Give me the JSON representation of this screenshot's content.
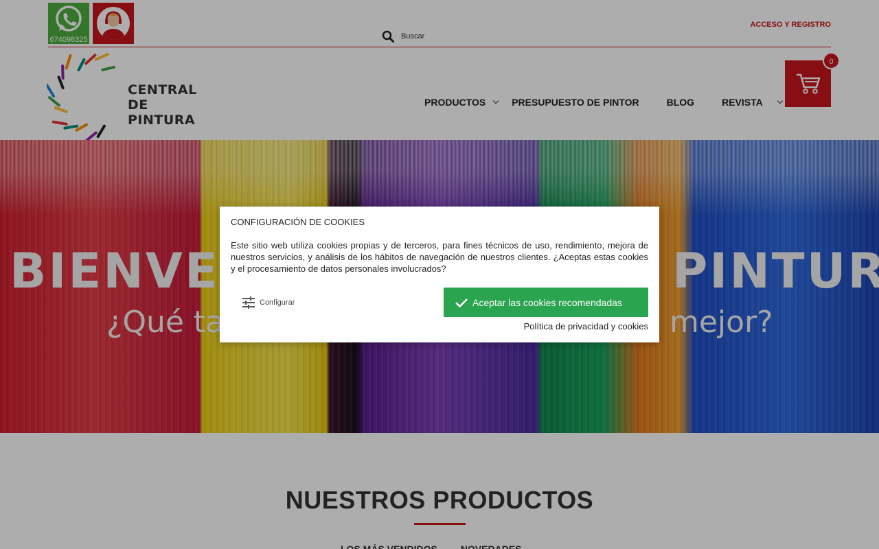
{
  "header": {
    "whatsapp_phone": "674098325",
    "search_label": "Buscar",
    "access_label": "ACCESO Y REGISTRO",
    "logo_line1": "CENTRAL",
    "logo_line2": "DE PINTURA",
    "cart_count": "0",
    "brand_color": "#c8161d",
    "whatsapp_color": "#4caf3f"
  },
  "nav": {
    "items": [
      {
        "label": "PRODUCTOS",
        "has_dropdown": true
      },
      {
        "label": "PRESUPUESTO DE PINTOR",
        "has_dropdown": false
      },
      {
        "label": "BLOG",
        "has_dropdown": false
      },
      {
        "label": "REVISTA",
        "has_dropdown": true
      }
    ]
  },
  "hero": {
    "title_left": "BIENVEN",
    "title_right": "PINTURA",
    "subtitle_left": "¿Qué ta",
    "subtitle_right": "mejor?"
  },
  "cookie_modal": {
    "title": "CONFIGURACIÓN DE COOKIES",
    "text": "Este sitio web utiliza cookies propias y de terceros, para fines técnicos de uso, rendimiento, mejora de nuestros servicios, y análisis de los hábitos de navegación de nuestros clientes. ¿Aceptas estas cookies y el procesamiento de datos personales involucrados?",
    "configure_label": "Configurar",
    "accept_label": "Aceptar las cookies recomendadas",
    "privacy_label": "Política de privacidad y cookies",
    "accept_color": "#2aa44f"
  },
  "products_section": {
    "title": "NUESTROS PRODUCTOS",
    "tabs": [
      "LOS MÁS VENDIDOS",
      "NOVEDADES"
    ]
  },
  "icons": [
    "whatsapp-icon",
    "support-agent-icon",
    "search-icon",
    "cart-icon",
    "chevron-down-icon",
    "settings-sliders-icon",
    "check-icon"
  ]
}
